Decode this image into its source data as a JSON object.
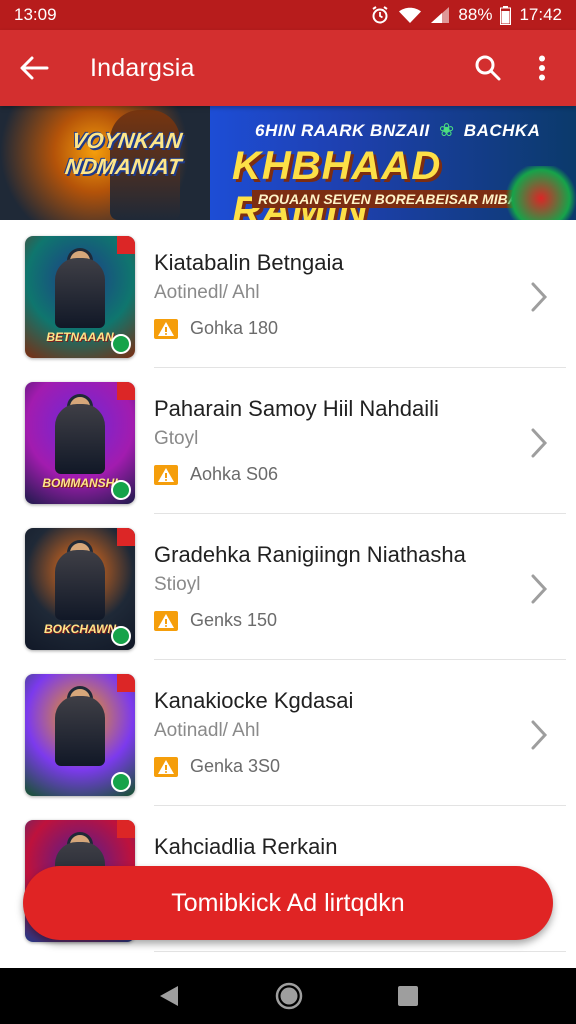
{
  "status_bar": {
    "time_left": "13:09",
    "battery": "88%",
    "time_right": "17:42"
  },
  "app_bar": {
    "title": "Indargsia",
    "back_icon": "arrow-left-icon",
    "search_icon": "search-icon",
    "menu_icon": "more-vert-icon"
  },
  "banner": {
    "left_title": "VOYNKAN NDMANIAT",
    "top_line": "6HIN RAARK BNZAII",
    "top_line_right": "BACHKA",
    "headline": "KHBHAAD RAMIN",
    "bottom_line": "ROUAAN SEVEN BOREABEISAR MIBASF"
  },
  "items": [
    {
      "name": "Kiatabalin Betngaia",
      "sub": "Aotinedl/ Ahl",
      "meta": "Gohka 180",
      "thumb_caption": "BETNAAAN",
      "thumb_colors": [
        "#1e3a8a",
        "#0f766e",
        "#7c2d12"
      ]
    },
    {
      "name": "Paharain Samoy Hiil Nahdaili",
      "sub": "Gtoyl",
      "meta": "Aohka S06",
      "thumb_caption": "BOMMANSHI",
      "thumb_colors": [
        "#6d28d9",
        "#a21caf",
        "#1e1b4b"
      ]
    },
    {
      "name": "Gradehka Ranigiingn Niathasha",
      "sub": "Stioyl",
      "meta": "Genks 150",
      "thumb_caption": "BOKCHAWN",
      "thumb_colors": [
        "#f97316",
        "#1f2937",
        "#111827"
      ]
    },
    {
      "name": "Kanakiocke Kgdasai",
      "sub": "Aotinadl/ Ahl",
      "meta": "Genka 3S0",
      "thumb_caption": "",
      "thumb_colors": [
        "#f59e0b",
        "#7c3aed",
        "#14532d"
      ]
    },
    {
      "name": "Kahciadlia Rerkain",
      "sub": "",
      "meta": "",
      "thumb_caption": "",
      "thumb_colors": [
        "#4c1d95",
        "#be123c",
        "#1e3a8a"
      ]
    }
  ],
  "cta": {
    "label": "Tomibkick Ad lirtqdkn"
  },
  "colors": {
    "app_bar": "#d32f2f",
    "status_bar": "#b71c1c",
    "accent": "#e02424",
    "warning": "#f59e0b"
  },
  "nav_bar": {
    "back": "nav-back-icon",
    "home": "nav-home-icon",
    "recents": "nav-recents-icon"
  }
}
